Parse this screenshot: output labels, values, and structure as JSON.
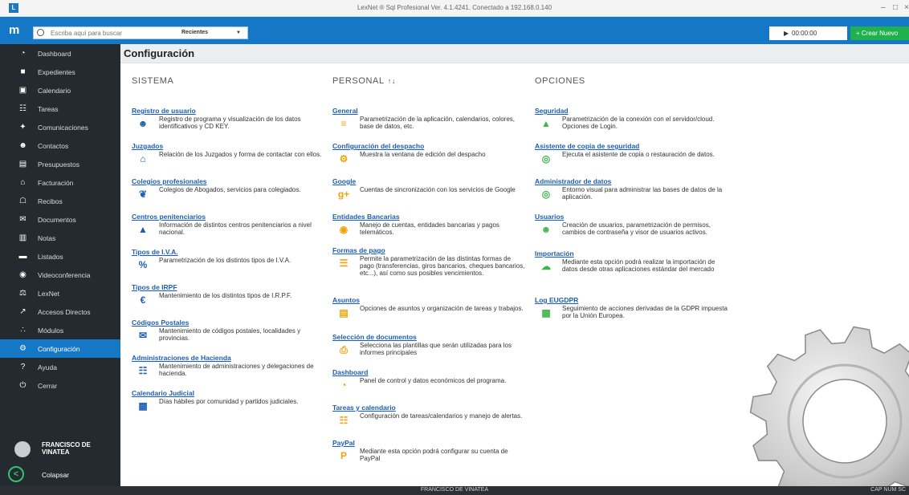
{
  "window": {
    "title": "LexNet ® Sql Profesional Ver. 4.1.4241. Conectado a 192.168.0.140",
    "controls": [
      "–",
      "□",
      "×"
    ]
  },
  "toolbar": {
    "search_placeholder": "Escriba aquí para buscar",
    "recent_label": "Recientes",
    "timer": "00:00:00",
    "create_label": "Crear Nuevo"
  },
  "sidebar": {
    "items": [
      {
        "label": "Dashboard",
        "icon": "dashboard-icon",
        "glyph": "◔"
      },
      {
        "label": "Expedientes",
        "icon": "briefcase-icon",
        "glyph": "■"
      },
      {
        "label": "Calendario",
        "icon": "calendar-icon",
        "glyph": "▣"
      },
      {
        "label": "Tareas",
        "icon": "tasks-icon",
        "glyph": "☷"
      },
      {
        "label": "Comunicaciones",
        "icon": "communications-icon",
        "glyph": "✦"
      },
      {
        "label": "Contactos",
        "icon": "contacts-icon",
        "glyph": "☻"
      },
      {
        "label": "Presupuestos",
        "icon": "budget-icon",
        "glyph": "▤"
      },
      {
        "label": "Facturación",
        "icon": "invoice-icon",
        "glyph": "⌂"
      },
      {
        "label": "Recibos",
        "icon": "bank-icon",
        "glyph": "☖"
      },
      {
        "label": "Documentos",
        "icon": "documents-icon",
        "glyph": "✉"
      },
      {
        "label": "Notas",
        "icon": "notes-icon",
        "glyph": "▥"
      },
      {
        "label": "Listados",
        "icon": "list-icon",
        "glyph": "▬"
      },
      {
        "label": "Videoconferencia",
        "icon": "video-icon",
        "glyph": "◉"
      },
      {
        "label": "LexNet",
        "icon": "lexnet-icon",
        "glyph": "⚖"
      },
      {
        "label": "Accesos Directos",
        "icon": "shortcut-icon",
        "glyph": "↗"
      },
      {
        "label": "Módulos",
        "icon": "modules-icon",
        "glyph": "∴"
      },
      {
        "label": "Configuración",
        "icon": "gear-icon",
        "glyph": "⚙"
      },
      {
        "label": "Ayuda",
        "icon": "help-icon",
        "glyph": "?"
      },
      {
        "label": "Cerrar",
        "icon": "power-icon",
        "glyph": "⏻"
      }
    ],
    "active_index": 16,
    "user_name": "FRANCISCO DE VINATEA",
    "collapse_label": "Colapsar"
  },
  "main": {
    "title": "Configuración",
    "columns": [
      {
        "heading": "SISTEMA",
        "items": [
          {
            "link": "Registro de usuario",
            "desc": "Registro de programa y visualización de los datos identificativos y CD KEY.",
            "icon": "user-key-icon",
            "glyph": "☻",
            "color": "#1a5fb4"
          },
          {
            "link": "Juzgados",
            "desc": "Relación de los Juzgados y forma de contactar con ellos.",
            "icon": "courthouse-icon",
            "glyph": "⌂",
            "color": "#1a5fb4"
          },
          {
            "link": "Colegios profesionales",
            "desc": "Colegios de Abogados, servicios para colegiados.",
            "icon": "handshake-icon",
            "glyph": "❦",
            "color": "#1a5fb4"
          },
          {
            "link": "Centros penitenciarios",
            "desc": "Información de distintos centros penitenciarios a nivel nacional.",
            "icon": "lock-icon",
            "glyph": "▲",
            "color": "#1a5fb4"
          },
          {
            "link": "Tipos de I.V.A.",
            "desc": "Parametrización de los distintos tipos de I.V.A.",
            "icon": "percent-icon",
            "glyph": "%",
            "color": "#1a5fb4"
          },
          {
            "link": "Tipos de IRPF",
            "desc": "Mantenimiento de los distintos tipos de I.R.P.F.",
            "icon": "euro-icon",
            "glyph": "€",
            "color": "#1a5fb4"
          },
          {
            "link": "Códigos Postales",
            "desc": "Mantenimiento de códigos postales, localidades y provincias.",
            "icon": "envelope-icon",
            "glyph": "✉",
            "color": "#1a5fb4"
          },
          {
            "link": "Administraciones de Hacienda",
            "desc": "Mantenimiento de administraciones y delegaciones de hacienda.",
            "icon": "calculator-icon",
            "glyph": "☷",
            "color": "#1a5fb4"
          },
          {
            "link": "Calendario Judicial",
            "desc": "Días hábiles por comunidad y partidos judiciales.",
            "icon": "judicial-calendar-icon",
            "glyph": "▦",
            "color": "#1a5fb4"
          }
        ]
      },
      {
        "heading": "PERSONAL",
        "sort_icon": "↑↓",
        "items": [
          {
            "link": "General",
            "desc": "Parametrización de la aplicación, calendarios, colores, base de datos, etc.",
            "icon": "sliders-icon",
            "glyph": "≡",
            "color": "#f0a30a"
          },
          {
            "link": "Configuración del despacho",
            "desc": "Muestra la ventana de edición del despacho",
            "icon": "gears-icon",
            "glyph": "⚙",
            "color": "#f0a30a"
          },
          {
            "link": "Google",
            "desc": "Cuentas de sincronización con los servicios de Google",
            "icon": "google-plus-icon",
            "glyph": "g+",
            "color": "#f0a30a"
          },
          {
            "link": "Entidades Bancarias",
            "desc": "Manejo de cuentas, entidades bancarias y pagos telemáticos.",
            "icon": "coins-icon",
            "glyph": "◉",
            "color": "#f0a30a"
          },
          {
            "link": "Formas de pago",
            "desc": "Permite la parametrización de las distintas formas de pago (transferencias, giros bancarios, cheques bancarios, etc...), así como sus posibles vencimientos.",
            "icon": "payment-list-icon",
            "glyph": "☰",
            "color": "#f0a30a"
          },
          {
            "link": "Asuntos",
            "desc": "Opciones de asuntos y organización de tareas y trabajos.",
            "icon": "matters-icon",
            "glyph": "▤",
            "color": "#f0a30a"
          },
          {
            "link": "Selección de documentos",
            "desc": "Selecciona las plantillas que serán utilizadas para los informes principales",
            "icon": "printer-icon",
            "glyph": "⎙",
            "color": "#f0a30a"
          },
          {
            "link": "Dashboard",
            "desc": "Panel de control y datos económicos del programa.",
            "icon": "dashboard-icon",
            "glyph": "◔",
            "color": "#f0a30a"
          },
          {
            "link": "Tareas y calendario",
            "desc": "Configuración de tareas/calendarios y manejo de alertas.",
            "icon": "tree-icon",
            "glyph": "☷",
            "color": "#f0a30a"
          },
          {
            "link": "PayPal",
            "desc": "Mediante esta opción podrá configurar su cuenta de PayPal",
            "icon": "paypal-icon",
            "glyph": "P",
            "color": "#f0a30a"
          }
        ]
      },
      {
        "heading": "OPCIONES",
        "items": [
          {
            "link": "Seguridad",
            "desc": "Parametrización de la conexión con el servidor/cloud. Opciones de Login.",
            "icon": "padlock-icon",
            "glyph": "▲",
            "color": "#3cb54a"
          },
          {
            "link": "Asistente de copia de seguridad",
            "desc": "Ejecuta el asistente de copia o restauración de datos.",
            "icon": "database-backup-icon",
            "glyph": "◎",
            "color": "#3cb54a"
          },
          {
            "link": "Administrador de datos",
            "desc": "Entorno visual para administrar las bases de datos de la aplicación.",
            "icon": "database-icon",
            "glyph": "◎",
            "color": "#3cb54a"
          },
          {
            "link": "Usuarios",
            "desc": "Creación de usuarios, parametrización de permisos, cambios de contraseña y visor de usuarios activos.",
            "icon": "users-icon",
            "glyph": "☻",
            "color": "#3cb54a"
          },
          {
            "link": "Importación",
            "desc": "Mediante esta opción podrá realizar la importación de datos desde otras aplicaciones estándar del mercado",
            "icon": "cloud-upload-icon",
            "glyph": "☁",
            "color": "#3cb54a"
          },
          {
            "link": "Log EUGDPR",
            "desc": "Seguimiento de acciones derivadas de la GDPR impuesta por la Unión Europea.",
            "icon": "gdpr-icon",
            "glyph": "▦",
            "color": "#3cb54a"
          }
        ]
      }
    ]
  },
  "statusbar": {
    "user": "FRANCISCO DE VINATEA",
    "flags": "CAP  NUM  SC"
  },
  "colors": {
    "accent": "#1478c7",
    "sidebar_bg": "#232a30",
    "create_green": "#20b14f",
    "link_blue": "#1a5fb4"
  }
}
